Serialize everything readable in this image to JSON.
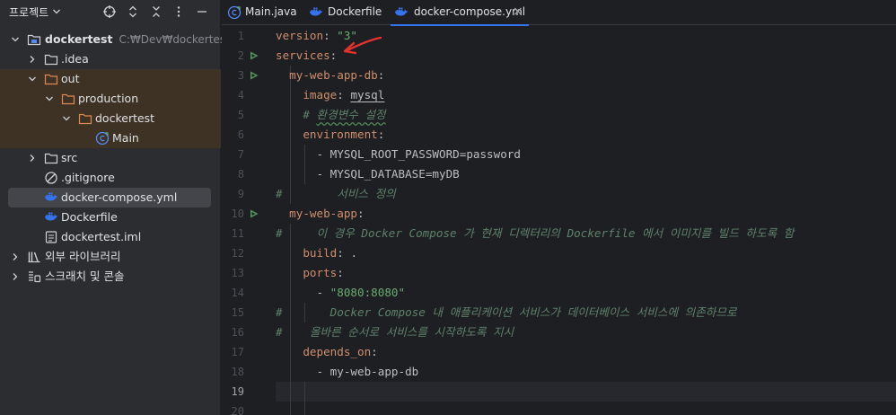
{
  "project_panel": {
    "title": "프로젝트",
    "header_icons": [
      "crosshair-icon",
      "expand-all-icon",
      "collapse-all-icon",
      "more-icon",
      "minimize-icon"
    ],
    "tree": [
      {
        "label": "dockertest",
        "path": "C:₩Dev₩dockertest",
        "icon": "project-folder-icon",
        "expanded": true
      },
      {
        "label": ".idea",
        "icon": "folder-icon",
        "expanded": false
      },
      {
        "label": "out",
        "icon": "folder-icon",
        "expanded": true
      },
      {
        "label": "production",
        "icon": "folder-icon",
        "expanded": true
      },
      {
        "label": "dockertest",
        "icon": "folder-icon",
        "expanded": true
      },
      {
        "label": "Main",
        "icon": "java-class-icon"
      },
      {
        "label": "src",
        "icon": "folder-icon",
        "expanded": false
      },
      {
        "label": ".gitignore",
        "icon": "gitignore-icon"
      },
      {
        "label": "docker-compose.yml",
        "icon": "docker-icon",
        "selected": true
      },
      {
        "label": "Dockerfile",
        "icon": "docker-icon"
      },
      {
        "label": "dockertest.iml",
        "icon": "iml-file-icon"
      },
      {
        "label": "외부 라이브러리",
        "icon": "library-icon",
        "expanded": false
      },
      {
        "label": "스크래치 및 콘솔",
        "icon": "scratch-icon",
        "expanded": false
      }
    ]
  },
  "editor": {
    "tabs": [
      {
        "label": "Main.java",
        "icon": "java-class-icon"
      },
      {
        "label": "Dockerfile",
        "icon": "docker-icon"
      },
      {
        "label": "docker-compose.yml",
        "icon": "docker-icon",
        "active": true,
        "close": "×"
      }
    ],
    "line_numbers": [
      "1",
      "2",
      "3",
      "4",
      "5",
      "6",
      "7",
      "8",
      "9",
      "10",
      "11",
      "12",
      "13",
      "14",
      "15",
      "16",
      "17",
      "18",
      "19",
      "20"
    ],
    "current_line": "19",
    "code": {
      "l1_key": "version",
      "l1_colon": ": ",
      "l1_val": "\"3\"",
      "l2_key": "services",
      "l2_colon": ":",
      "l3_indent": "  ",
      "l3_key": "my-web-app-db",
      "l3_colon": ":",
      "l4_indent": "    ",
      "l4_key": "image",
      "l4_colon": ": ",
      "l4_val": "mysql",
      "l5_indent": "    ",
      "l5_hash": "# ",
      "l5_text": "환경변수 설정",
      "l6_indent": "    ",
      "l6_key": "environment",
      "l6_colon": ":",
      "l7_indent": "      ",
      "l7_dash": "- ",
      "l7_val": "MYSQL_ROOT_PASSWORD=password",
      "l8_indent": "      ",
      "l8_dash": "- ",
      "l8_val": "MYSQL_DATABASE=myDB",
      "l9_hash": "#",
      "l9_text": "        서비스 정의",
      "l10_indent": "  ",
      "l10_key": "my-web-app",
      "l10_colon": ":",
      "l11_hash": "#",
      "l11_text": "     이 경우 Docker Compose 가 현재 디렉터리의 Dockerfile 에서 이미지를 빌드 하도록 함",
      "l12_indent": "    ",
      "l12_key": "build",
      "l12_colon": ": ",
      "l12_val": ".",
      "l13_indent": "    ",
      "l13_key": "ports",
      "l13_colon": ":",
      "l14_indent": "      ",
      "l14_dash": "- ",
      "l14_val": "\"8080:8080\"",
      "l15_hash": "#",
      "l15_text": "       Docker Compose 내 애플리케이션 서비스가 데이터베이스 서비스에 의존하므로",
      "l16_hash": "#",
      "l16_text": "    올바른 순서로 서비스를 시작하도록 지시",
      "l17_indent": "    ",
      "l17_key": "depends_on",
      "l17_colon": ":",
      "l18_indent": "      ",
      "l18_dash": "- ",
      "l18_val": "my-web-app-db"
    }
  },
  "annotation": {
    "color": "#e8322b",
    "points_to": "services"
  },
  "colors": {
    "accent": "#3574f0",
    "keyword": "#cf8e6d",
    "string": "#6aab73",
    "comment": "#5f826b",
    "excluded_bg": "#3d3223"
  }
}
